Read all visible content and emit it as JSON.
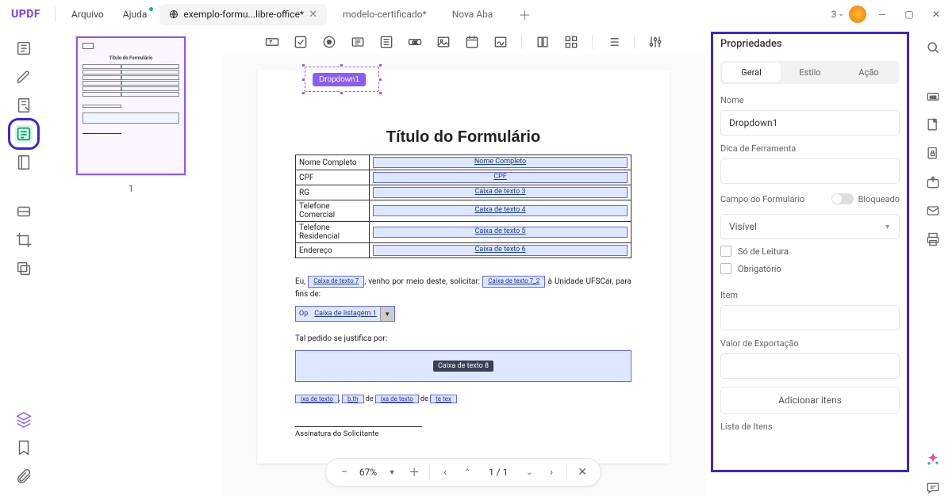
{
  "app": {
    "name": "UPDF"
  },
  "menu": {
    "file": "Arquivo",
    "help": "Ajuda"
  },
  "tabs": [
    {
      "label": "exemplo-formu...libre-office*",
      "active": true,
      "closable": true
    },
    {
      "label": "modelo-certificado*",
      "active": false
    },
    {
      "label": "Nova Aba",
      "active": false
    }
  ],
  "titlebar": {
    "count": "3"
  },
  "thumbs": {
    "page": "1"
  },
  "document": {
    "dropdown_chip": "Dropdown1",
    "title": "Título do Formulário",
    "rows": [
      {
        "label": "Nome Completo",
        "field": "Nome Completo"
      },
      {
        "label": "CPF",
        "field": "CPF"
      },
      {
        "label": "RG",
        "field": "Caixa de texto 3"
      },
      {
        "label": "Telefone Comercial",
        "field": "Caixa de texto 4"
      },
      {
        "label": "Telefone Residencial",
        "field": "Caixa de texto 5"
      },
      {
        "label": "Endereço",
        "field": "Caixa de texto 6"
      }
    ],
    "para_pre": "Eu, ",
    "para_f1": "Caixa de texto 7",
    "para_mid": ", venho por meio deste, solicitar: ",
    "para_f2": "Caixa de texto 7_2",
    "para_post": " à Unidade UFSCar, para fins de:",
    "list_prefix": "Op",
    "list_field": "Caixa de listagem 1",
    "justify_label": "Tal pedido se justifica por:",
    "bigbox": "Caixa de texto 8",
    "frag1": "ixa de texto",
    "frag_sep1": ", ",
    "frag2": "b.th",
    "frag_sep2": " de ",
    "frag3": "ixa de texto",
    "frag_sep3": " de ",
    "frag4": "te tex",
    "sig": "Assinatura do Solicitante"
  },
  "zoom": {
    "value": "67%",
    "pages": "1 / 1"
  },
  "props": {
    "title": "Propriedades",
    "tabs": {
      "general": "Geral",
      "style": "Estilo",
      "action": "Ação"
    },
    "name_label": "Nome",
    "name_value": "Dropdown1",
    "tooltip_label": "Dica de Ferramenta",
    "tooltip_value": "",
    "formfield_label": "Campo do Formulário",
    "locked_label": "Bloqueado",
    "visibility": "Visível",
    "readonly": "Só de Leitura",
    "required": "Obrigatório",
    "item_label": "Item",
    "item_value": "",
    "export_label": "Valor de Exportação",
    "export_value": "",
    "add_btn": "Adicionar itens",
    "list_label": "Lista de Itens"
  }
}
